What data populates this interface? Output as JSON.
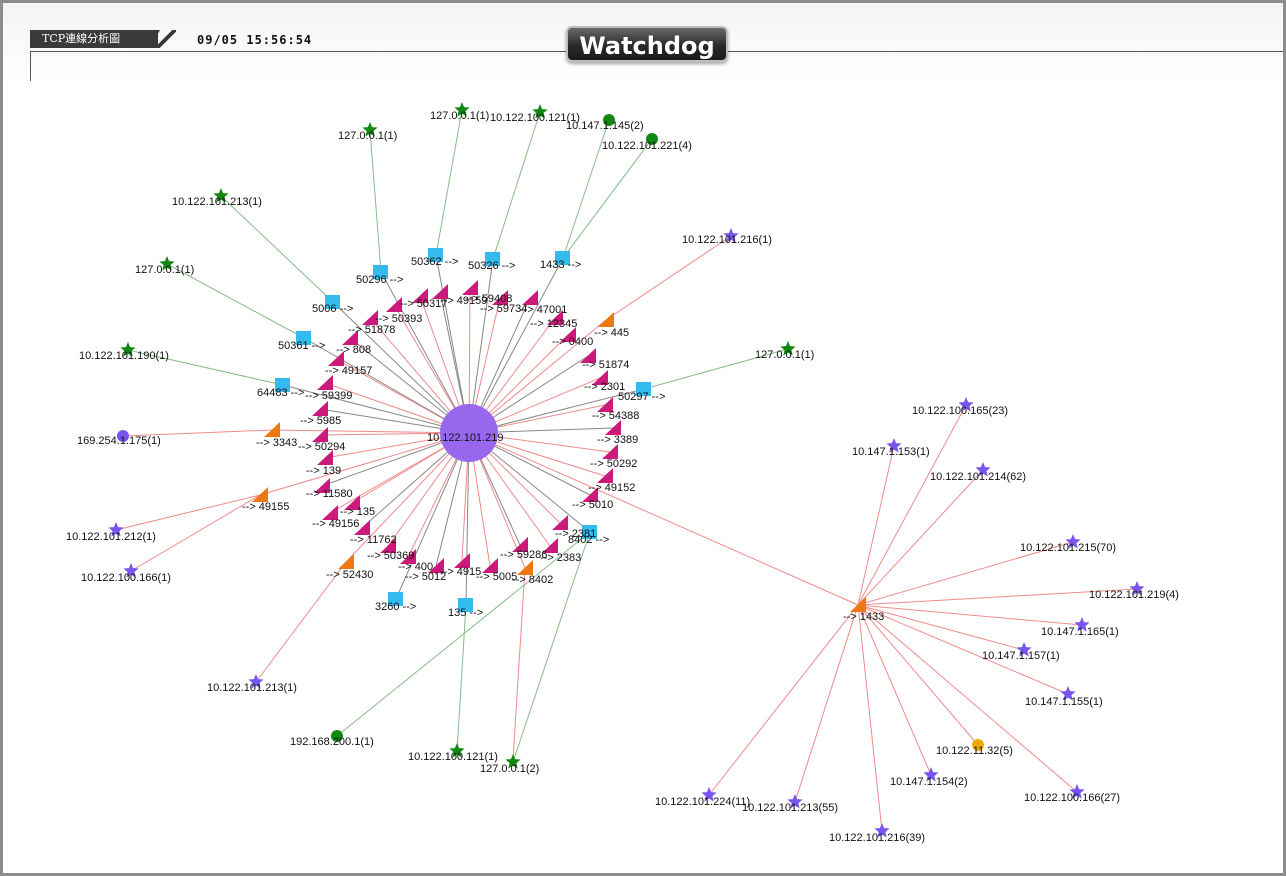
{
  "header": {
    "title": "TCP連線分析圖",
    "timestamp": "09/05 15:56:54",
    "logo": "Watchdog"
  },
  "colors": {
    "hub": "#9966ee",
    "port_triangle": "#cc1a7a",
    "orange_triangle": "#ee7711",
    "square": "#33bbee",
    "green": "#118811",
    "purple_star": "#7755ee",
    "yellow": "#eeaa00",
    "edge_red": "#f08a8a",
    "edge_green": "#88bb88",
    "edge_gray": "#888888"
  },
  "graph": {
    "hubs": [
      {
        "id": "hub1",
        "label": "10.122.101.219"
      },
      {
        "id": "hub2",
        "label": "--> 1433"
      }
    ],
    "host_labels": [
      "127.0.0.1(1)",
      "127.0.0.1(1)",
      "10.122.100.121(1)",
      "10.147.1.145(2)",
      "10.122.101.221(4)",
      "10.122.101.213(1)",
      "127.0.0.1(1)",
      "10.122.101.190(1)",
      "169.254.1.175(1)",
      "10.122.101.212(1)",
      "10.122.100.166(1)",
      "10.122.101.213(1)",
      "192.168.200.1(1)",
      "10.122.100.121(1)",
      "127.0.0.1(2)",
      "127.0.0.1(1)",
      "10.122.101.216(1)",
      "10.122.100.165(23)",
      "10.147.1.153(1)",
      "10.122.101.214(62)",
      "10.122.101.215(70)",
      "10.122.101.219(4)",
      "10.147.1.165(1)",
      "10.147.1.157(1)",
      "10.147.1.155(1)",
      "10.122.11.32(5)",
      "10.147.1.154(2)",
      "10.122.100.166(27)",
      "10.122.101.224(11)",
      "10.122.101.213(55)",
      "10.122.101.216(39)"
    ],
    "port_labels": [
      "--> 50317",
      "--> 49159",
      "--> 59408",
      "--> 59734",
      "--> 47001",
      "--> 12345",
      "--> 0400",
      "--> 51874",
      "--> 2301",
      "--> 54388",
      "--> 3389",
      "--> 50292",
      "--> 49152",
      "--> 5010",
      "--> 2381",
      "--> 2383",
      "--> 59286",
      "--> 5005",
      "--> 4915",
      "--> 5012",
      "--> 400",
      "--> 50369",
      "--> 11762",
      "--> 49156",
      "--> 135",
      "--> 11580",
      "--> 139",
      "--> 50294",
      "--> 5985",
      "--> 59399",
      "--> 49157",
      "--> 808",
      "--> 51878",
      "--> 50393",
      "--> 445",
      "--> 3343",
      "--> 49155",
      "--> 52430",
      "--> 8402"
    ],
    "square_labels": [
      "50296 -->",
      "50362 -->",
      "50326 -->",
      "1433 -->",
      "5006 -->",
      "50361 -->",
      "64483 -->",
      "50297 -->",
      "8402 -->",
      "3260 -->",
      "135 -->"
    ]
  }
}
